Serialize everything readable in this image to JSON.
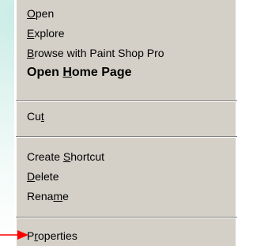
{
  "menu": {
    "items": [
      {
        "pre": "",
        "key": "O",
        "post": "pen"
      },
      {
        "pre": "",
        "key": "E",
        "post": "xplore"
      },
      {
        "pre": "",
        "key": "B",
        "post": "rowse with Paint Shop Pro"
      },
      {
        "pre": "Open ",
        "key": "H",
        "post": "ome Page"
      },
      {
        "pre": "Cu",
        "key": "t",
        "post": ""
      },
      {
        "pre": "Create ",
        "key": "S",
        "post": "hortcut"
      },
      {
        "pre": "",
        "key": "D",
        "post": "elete"
      },
      {
        "pre": "Rena",
        "key": "m",
        "post": "e"
      },
      {
        "pre": "P",
        "key": "r",
        "post": "operties"
      }
    ]
  },
  "colors": {
    "menu_bg": "#d4d0c8",
    "arrow": "#ff0000"
  },
  "icons": {
    "pointer": "red-arrow-icon"
  }
}
